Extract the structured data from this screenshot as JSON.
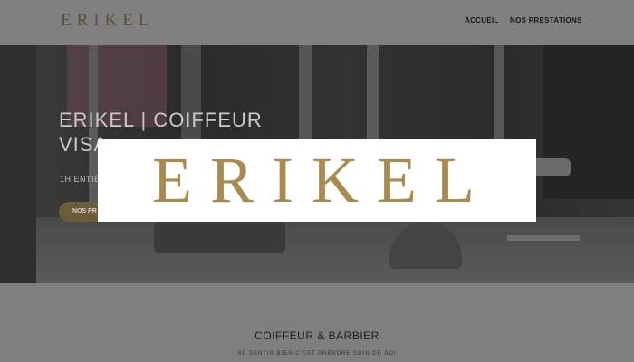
{
  "header": {
    "logo": "ERIKEL",
    "nav": [
      "ACCUEIL",
      "NOS PRESTATIONS"
    ]
  },
  "hero": {
    "title": "ERIKEL | COIFFEUR\nVISA",
    "subtitle": "1H ENTIÈ",
    "button_label": "NOS PR"
  },
  "overlay": {
    "logo": "ERIKEL"
  },
  "section": {
    "title": "COIFFEUR & BARBIER",
    "subtitle": "SE SENTIR BIEN C'EST PRENDRE SOIN DE SOI"
  },
  "colors": {
    "brand_gold": "#a98a4f",
    "button": "#6b5c3a"
  }
}
